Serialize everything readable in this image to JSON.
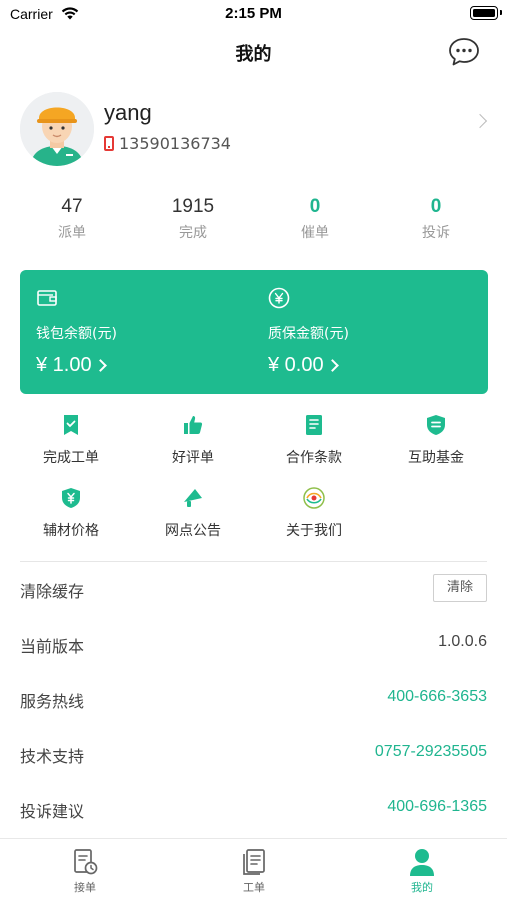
{
  "status_bar": {
    "carrier": "Carrier",
    "time": "2:15 PM"
  },
  "nav": {
    "title": "我的"
  },
  "profile": {
    "username": "yang",
    "phone": "13590136734"
  },
  "stats": [
    {
      "value": "47",
      "label": "派单"
    },
    {
      "value": "1915",
      "label": "完成"
    },
    {
      "value": "0",
      "label": "催单"
    },
    {
      "value": "0",
      "label": "投诉"
    }
  ],
  "wallet": {
    "balance_label": "钱包余额(元)",
    "balance_value": "¥ 1.00",
    "deposit_label": "质保金额(元)",
    "deposit_value": "¥ 0.00"
  },
  "grid": [
    {
      "label": "完成工单",
      "icon": "completed-order-icon"
    },
    {
      "label": "好评单",
      "icon": "thumbs-up-icon"
    },
    {
      "label": "合作条款",
      "icon": "document-icon"
    },
    {
      "label": "互助基金",
      "icon": "fund-icon"
    },
    {
      "label": "辅材价格",
      "icon": "price-tag-icon"
    },
    {
      "label": "网点公告",
      "icon": "megaphone-icon"
    },
    {
      "label": "关于我们",
      "icon": "logo-icon"
    }
  ],
  "settings": {
    "clear_cache": {
      "label": "清除缓存",
      "button": "清除"
    },
    "version": {
      "label": "当前版本",
      "value": "1.0.0.6"
    },
    "hotline": {
      "label": "服务热线",
      "value": "400-666-3653"
    },
    "support": {
      "label": "技术支持",
      "value": "0757-29235505"
    },
    "complaint": {
      "label": "投诉建议",
      "value": "400-696-1365"
    }
  },
  "tabbar": [
    {
      "label": "接单",
      "icon": "order-receive-icon",
      "active": false
    },
    {
      "label": "工单",
      "icon": "work-order-icon",
      "active": false
    },
    {
      "label": "我的",
      "icon": "profile-icon",
      "active": true
    }
  ],
  "colors": {
    "accent": "#1ebb8f",
    "text": "#333333",
    "muted": "#999999",
    "phone_icon": "#e53935"
  }
}
